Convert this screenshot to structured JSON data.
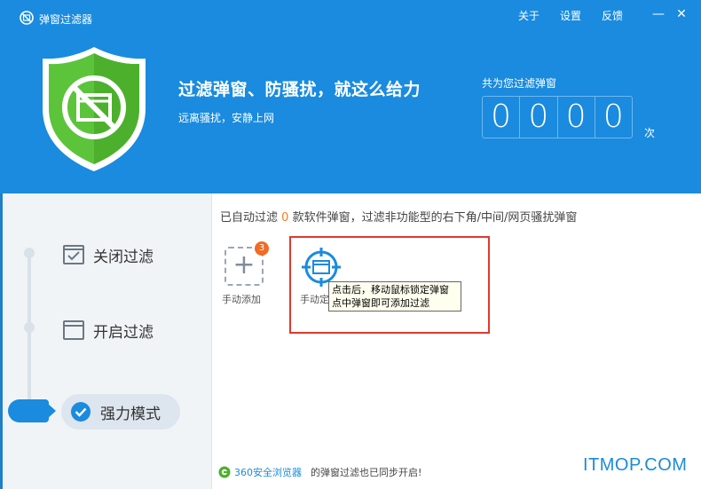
{
  "window": {
    "title": "弹窗过滤器",
    "links": [
      "关于",
      "设置",
      "反馈"
    ],
    "minimize_glyph": "—",
    "close_glyph": "✕"
  },
  "banner": {
    "slogan": "过滤弹窗、防骚扰，就这么给力",
    "sub_slogan": "远离骚扰，安静上网",
    "counter_label": "共为您过滤弹窗",
    "counter_digits": [
      "0",
      "0",
      "0",
      "0"
    ],
    "counter_unit": "次"
  },
  "sidebar": {
    "items": [
      {
        "label": "关闭过滤",
        "icon": "checkbox-window-icon"
      },
      {
        "label": "开启过滤",
        "icon": "window-icon"
      },
      {
        "label": "强力模式",
        "icon": "check-circle-icon",
        "active": true
      }
    ]
  },
  "main": {
    "status_prefix": "已自动过滤",
    "status_count": "0",
    "status_suffix": "款软件弹窗，过滤非功能型的右下角/中间/网页骚扰弹窗",
    "add_badge": "3",
    "add_label": "手动添加",
    "target_label": "手动定位",
    "tooltip_line1": "点击后，移动鼠标锁定弹窗",
    "tooltip_line2": "点中弹窗即可添加过滤"
  },
  "footer": {
    "link_text": "360安全浏览器",
    "text": "的弹窗过滤也已同步开启!"
  },
  "watermark": "ITMOP.COM",
  "colors": {
    "brand_blue": "#1a8bde",
    "shield_green": "#5cc43a",
    "highlight_red": "#e0392d",
    "badge_orange": "#f06b25"
  }
}
